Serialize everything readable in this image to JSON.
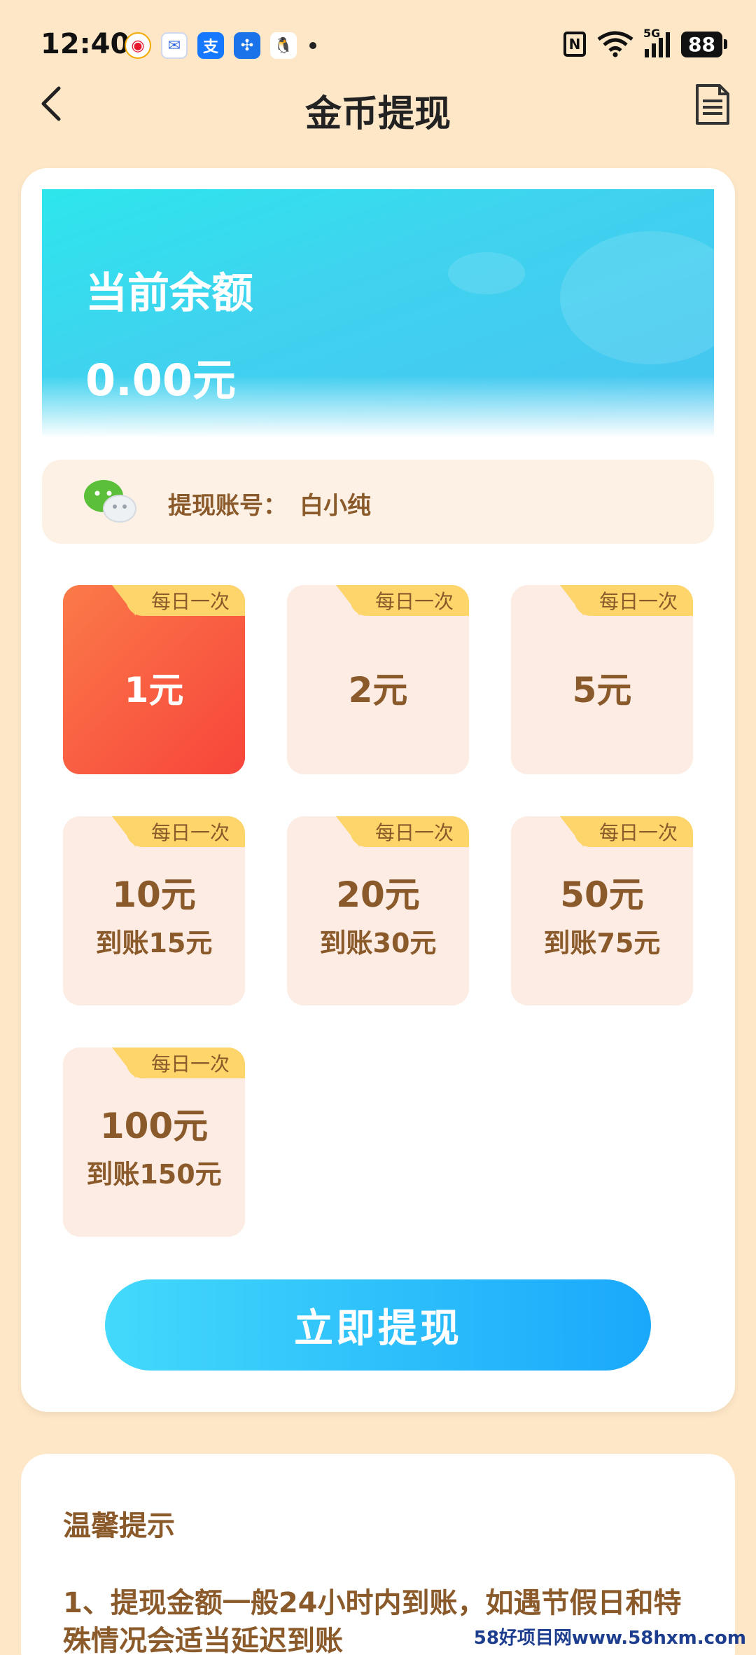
{
  "status_bar": {
    "time": "12:40",
    "network": "5G",
    "battery": "88",
    "notifications": [
      "weibo-icon",
      "message-icon",
      "alipay-icon",
      "pinwheel-icon",
      "qq-icon"
    ]
  },
  "header": {
    "title": "金币提现"
  },
  "balance": {
    "label": "当前余额",
    "value": "0.00元"
  },
  "account": {
    "label": "提现账号：",
    "name": "白小纯"
  },
  "options": [
    {
      "amount": "1元",
      "tag": "每日一次",
      "bonus": "",
      "selected": true
    },
    {
      "amount": "2元",
      "tag": "每日一次",
      "bonus": "",
      "selected": false
    },
    {
      "amount": "5元",
      "tag": "每日一次",
      "bonus": "",
      "selected": false
    },
    {
      "amount": "10元",
      "tag": "每日一次",
      "bonus": "到账15元",
      "selected": false
    },
    {
      "amount": "20元",
      "tag": "每日一次",
      "bonus": "到账30元",
      "selected": false
    },
    {
      "amount": "50元",
      "tag": "每日一次",
      "bonus": "到账75元",
      "selected": false
    },
    {
      "amount": "100元",
      "tag": "每日一次",
      "bonus": "到账150元",
      "selected": false
    }
  ],
  "withdraw_button": "立即提现",
  "tips": {
    "title": "温馨提示",
    "line1": "1、提现金额一般24小时内到账，如遇节假日和特殊情况会适当延迟到账"
  },
  "watermark": "58好项目网www.58hxm.com",
  "colors": {
    "background": "#fde7c7",
    "accent_brown": "#8b5a2b",
    "selected_gradient_start": "#fb7a49",
    "selected_gradient_end": "#f7453b",
    "button_start": "#43d9fb",
    "button_end": "#1aa8fb",
    "tag_yellow": "#fdd56a"
  }
}
